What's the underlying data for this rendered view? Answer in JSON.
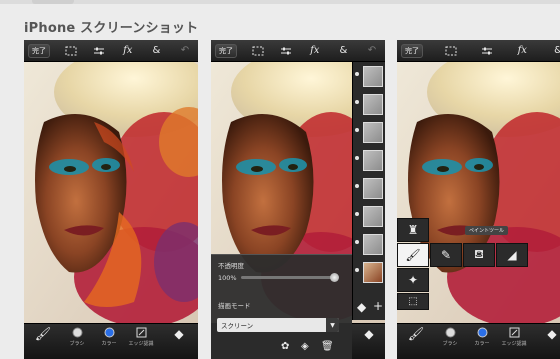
{
  "heading": "iPhone スクリーンショット",
  "toolbar": {
    "done_label": "完了",
    "fx_label": "fx",
    "amp_label": "&"
  },
  "bottombar": {
    "brush_label": "ブラシ",
    "color_label": "カラー",
    "edge_label": "エッジ認識"
  },
  "layer_panel": {
    "opacity_label": "不透明度",
    "opacity_value": "100%",
    "opacity_fraction": 1.0,
    "blend_label": "描画モード",
    "blend_value": "スクリーン"
  },
  "tools": {
    "tooltip": "ペイントツール"
  },
  "colors": {
    "toolbar_bg": "#2a2a2a",
    "bottombar_bg": "#1e1e1e",
    "color_dot": "#2a6fe8",
    "heading": "#555555"
  },
  "icons": [
    "selection-icon",
    "adjust-icon",
    "fx-icon",
    "ampersand-icon",
    "undo-icon",
    "brush-icon",
    "layers-icon",
    "trash-icon",
    "add-icon",
    "stamp-icon",
    "eraser-icon",
    "magic-wand-icon"
  ]
}
